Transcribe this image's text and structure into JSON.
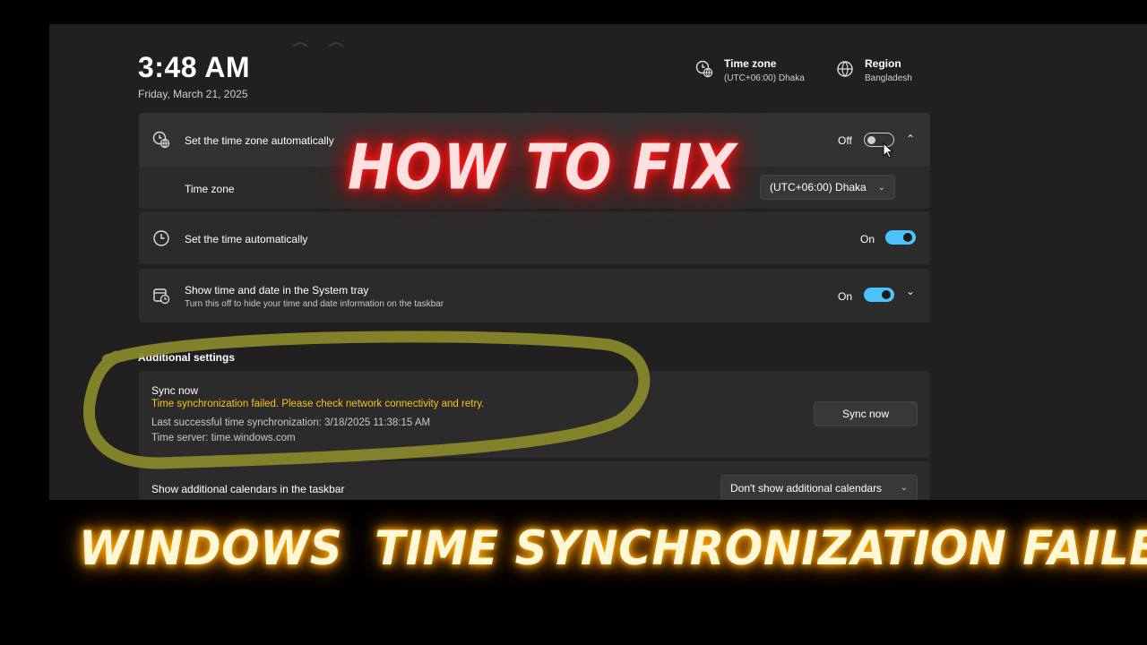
{
  "header": {
    "time": "3:48 AM",
    "date": "Friday, March 21, 2025",
    "timezone": {
      "title": "Time zone",
      "value": "(UTC+06:00) Dhaka",
      "icon": "timezone-icon"
    },
    "region": {
      "title": "Region",
      "value": "Bangladesh",
      "icon": "globe-icon"
    }
  },
  "settings": {
    "auto_timezone": {
      "label": "Set the time zone automatically",
      "state": "Off",
      "icon": "timezone-sync-icon"
    },
    "time_zone": {
      "label": "Time zone",
      "value": "(UTC+06:00) Dhaka"
    },
    "auto_time": {
      "label": "Set the time automatically",
      "state": "On",
      "icon": "clock-icon"
    },
    "system_tray": {
      "label": "Show time and date in the System tray",
      "description": "Turn this off to hide your time and date information on the taskbar",
      "state": "On",
      "icon": "calendar-clock-icon"
    }
  },
  "additional": {
    "header": "Additional settings",
    "sync": {
      "title": "Sync now",
      "error": "Time synchronization failed. Please check network connectivity and retry.",
      "last_sync": "Last successful time synchronization: 3/18/2025 11:38:15 AM",
      "server": "Time server: time.windows.com",
      "button": "Sync now"
    },
    "calendars": {
      "label": "Show additional calendars in the taskbar",
      "value": "Don't show additional calendars"
    }
  },
  "overlay": {
    "headline": "HOW TO FIX",
    "caption": "WINDOWS  TIME SYNCHRONIZATION FAILED"
  },
  "colors": {
    "accent": "#4cc2ff",
    "error_text": "#f5c518",
    "highlight_circle": "#8a8a2a",
    "headline_glow": "#ff1a1a",
    "caption_glow": "#ff9800"
  }
}
